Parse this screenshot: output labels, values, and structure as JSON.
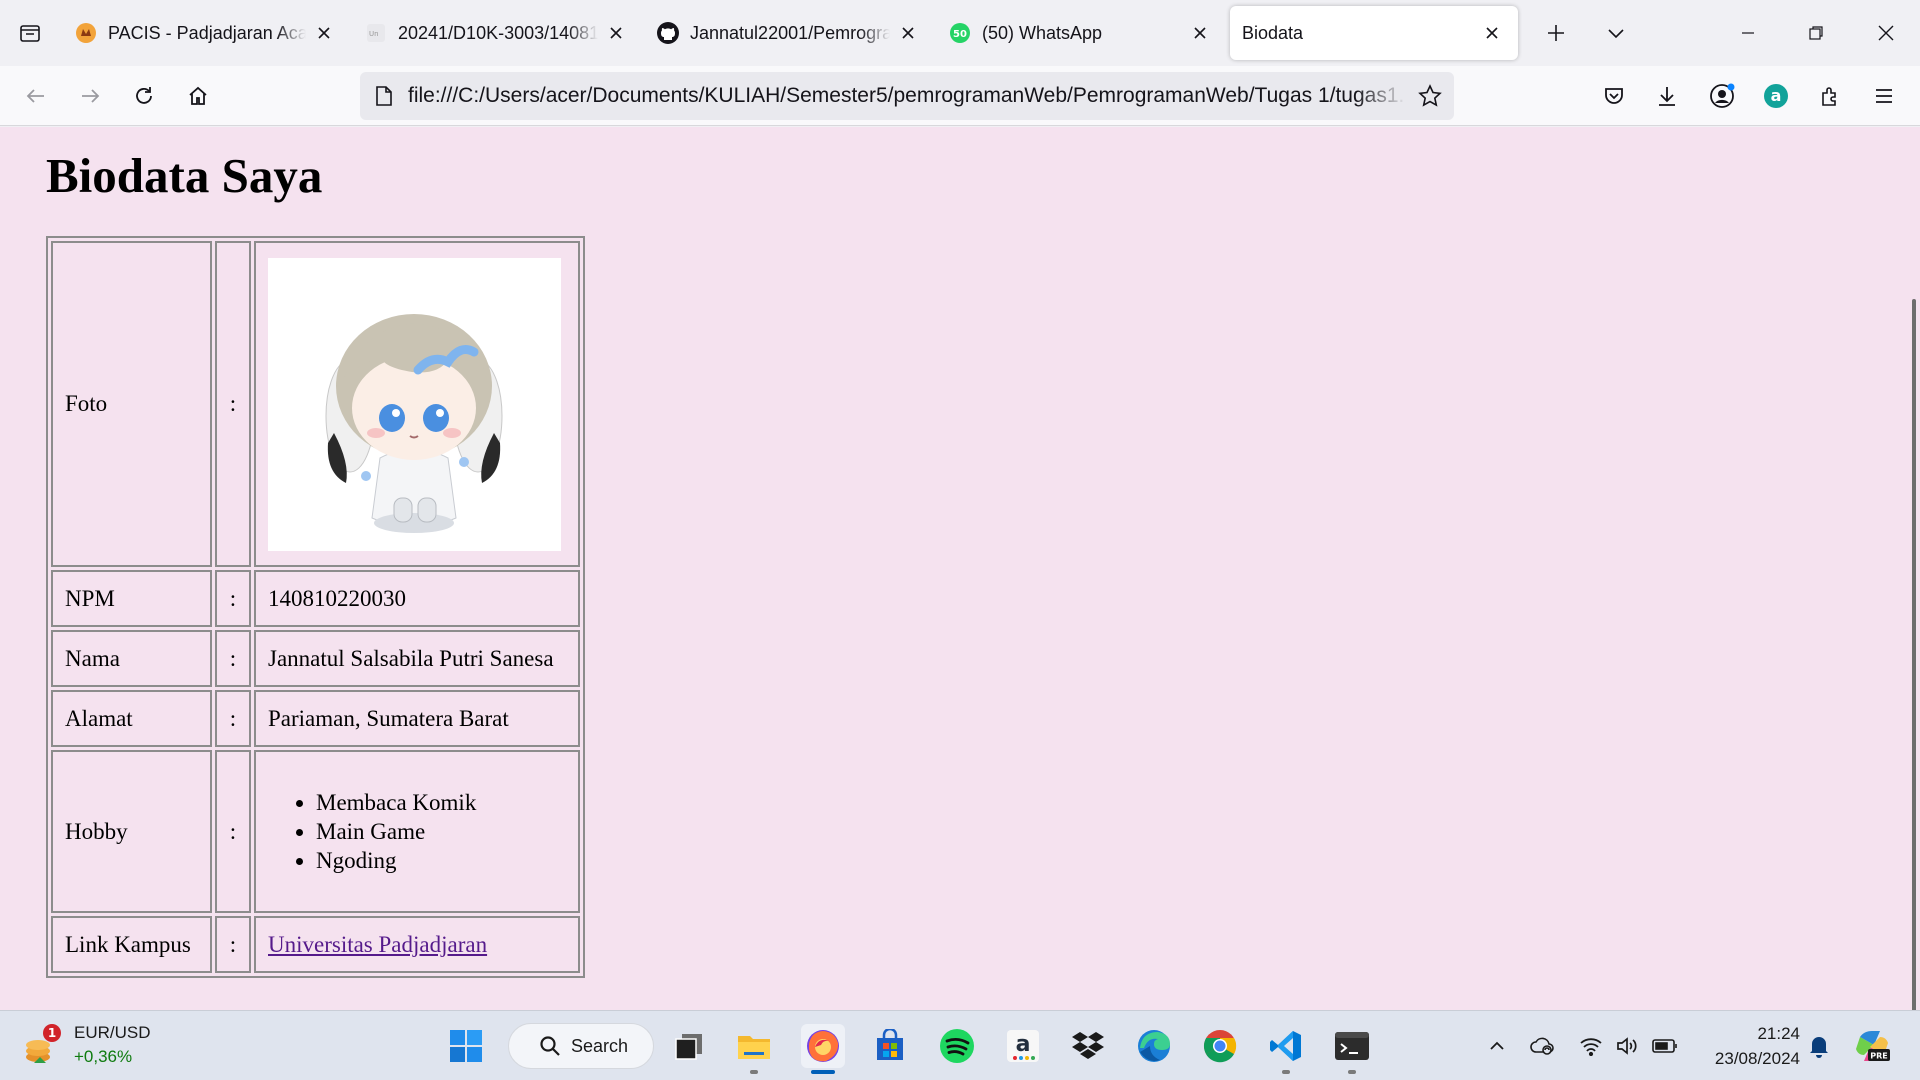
{
  "browser": {
    "tabs": [
      {
        "title": "PACIS - Padjadjaran Academic",
        "icon": "pacis-favicon"
      },
      {
        "title": "20241/D10K-3003/140810",
        "icon": "unpad-favicon"
      },
      {
        "title": "Jannatul22001/Pemrograman",
        "icon": "github-icon"
      },
      {
        "title": "(50) WhatsApp",
        "icon": "whatsapp-icon",
        "badge": "50"
      },
      {
        "title": "Biodata",
        "icon": "none",
        "active": true
      }
    ],
    "url": "file:///C:/Users/acer/Documents/KULIAH/Semester5/pemrogramanWeb/PemrogramanWeb/Tugas 1/tugas1.html"
  },
  "page": {
    "heading": "Biodata Saya",
    "colon": ":",
    "rows": {
      "foto": {
        "label": "Foto"
      },
      "npm": {
        "label": "NPM",
        "value": "140810220030"
      },
      "nama": {
        "label": "Nama",
        "value": "Jannatul Salsabila Putri Sanesa"
      },
      "alamat": {
        "label": "Alamat",
        "value": "Pariaman, Sumatera Barat"
      },
      "hobby": {
        "label": "Hobby",
        "items": [
          "Membaca Komik",
          "Main Game",
          "Ngoding"
        ]
      },
      "link": {
        "label": "Link Kampus",
        "value": "Universitas Padjadjaran"
      }
    }
  },
  "taskbar": {
    "widget": {
      "pair": "EUR/USD",
      "change": "+0,36%",
      "badge": "1"
    },
    "search_label": "Search",
    "time": "21:24",
    "date": "23/08/2024",
    "copilot_badge": "PRE"
  },
  "colors": {
    "page_bg": "#f5e2ef",
    "link": "#551a8b",
    "table_border": "#8c8c8c",
    "positive": "#0f7b0f"
  }
}
